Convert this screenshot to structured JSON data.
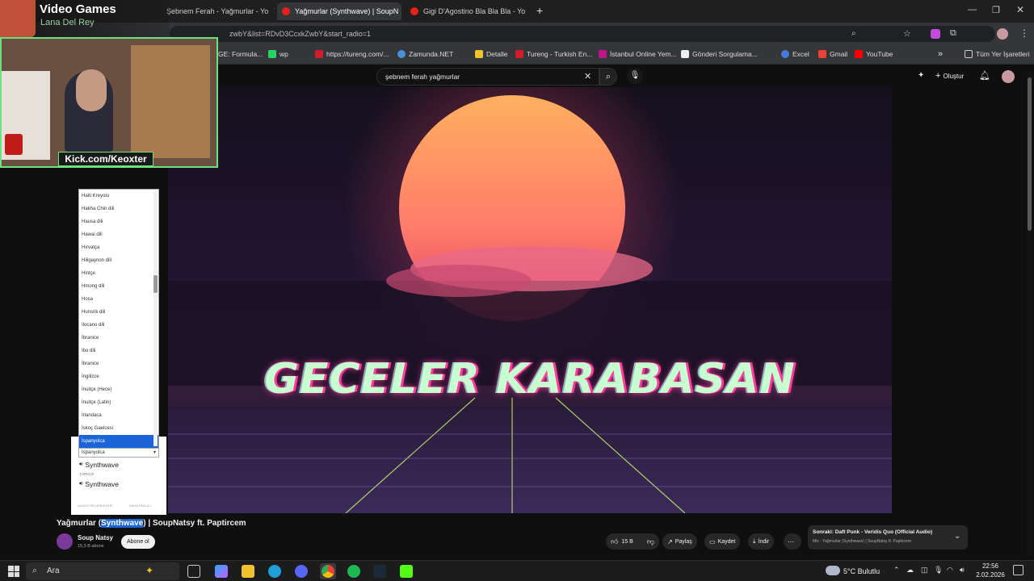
{
  "stream_overlay": {
    "title": "Video Games",
    "subtitle": "Lana Del Rey",
    "cam_caption": "Kick.com/Keoxter"
  },
  "tabs": [
    {
      "label": "Şebnem Ferah - Yağmurlar - Yo",
      "active": false
    },
    {
      "label": "Yağmurlar (Synthwave) | SoupN",
      "active": true
    },
    {
      "label": "Gigi D'Agostino Bla Bla Bla - Yo",
      "active": false
    }
  ],
  "new_tab_label": "+",
  "url": "zwbY&list=RDvD3CcxkZwbY&start_radio=1",
  "bookmarks": [
    "GE: Formula...",
    "wp",
    "https://tureng.com/...",
    "Zamunda.NET",
    "Detalle",
    "Tureng - Turkish En...",
    "İstanbul Online Yem...",
    "Gönderi Sorgulama...",
    "Excel",
    "Gmail",
    "YouTube"
  ],
  "bookmarks_more": "»",
  "all_bookmarks": "Tüm Yer İşaretleri",
  "yt": {
    "search_value": "şebnem ferah yağmurlar",
    "create_label": "Oluştur"
  },
  "video": {
    "overlay_text": "GECELER KARABASAN"
  },
  "language_list": [
    "Haiti Kreyolu",
    "Hakha Chin dili",
    "Hausa dili",
    "Hawai dili",
    "Hırvatça",
    "Hiligaynon dili",
    "Hintçe",
    "Hmong dili",
    "Hosa",
    "Hunsrik dili",
    "Ilocano dili",
    "İbranice",
    "Ibo dili",
    "İbranice",
    "İngilizce",
    "İnuitçe (Hece)",
    "İnuitçe (Latin)",
    "İrlandaca",
    "İskoç Gaelcesi",
    "İspanyolca"
  ],
  "selected_language": "İspanyolca",
  "lang_select_value": "İspanyolca",
  "panel": {
    "track1": "Synthwave",
    "section": "TÜRKÇE",
    "track2": "Synthwave",
    "footer_left": "UZANTI SEÇENEKLERİ",
    "footer_right": "DAHA FAZLA »"
  },
  "video_title_pre": "Yağmurlar (",
  "video_title_hl": "Synthwave",
  "video_title_post": ") | SoupNatsy ft. Paptircem",
  "channel": {
    "name": "Soup Natsy",
    "subs": "15,3 B abone",
    "subscribe": "Abone ol"
  },
  "actions": {
    "likes": "15 B",
    "share": "Paylaş",
    "save": "Kaydet",
    "download": "İndir"
  },
  "up_next": {
    "title": "Sonraki: Daft Punk - Veridis Quo (Official Audio)",
    "sub": "Mix - Yağmurlar (Synthwave) | SoupNatsy ft. Paptircem"
  },
  "taskbar": {
    "search": "Ara",
    "weather": "5°C  Bulutlu",
    "time": "22:56",
    "date": "2.02.2026"
  },
  "colors": {
    "highlight": "#1a64d8",
    "subscribe_bg": "#f1f1f1"
  }
}
